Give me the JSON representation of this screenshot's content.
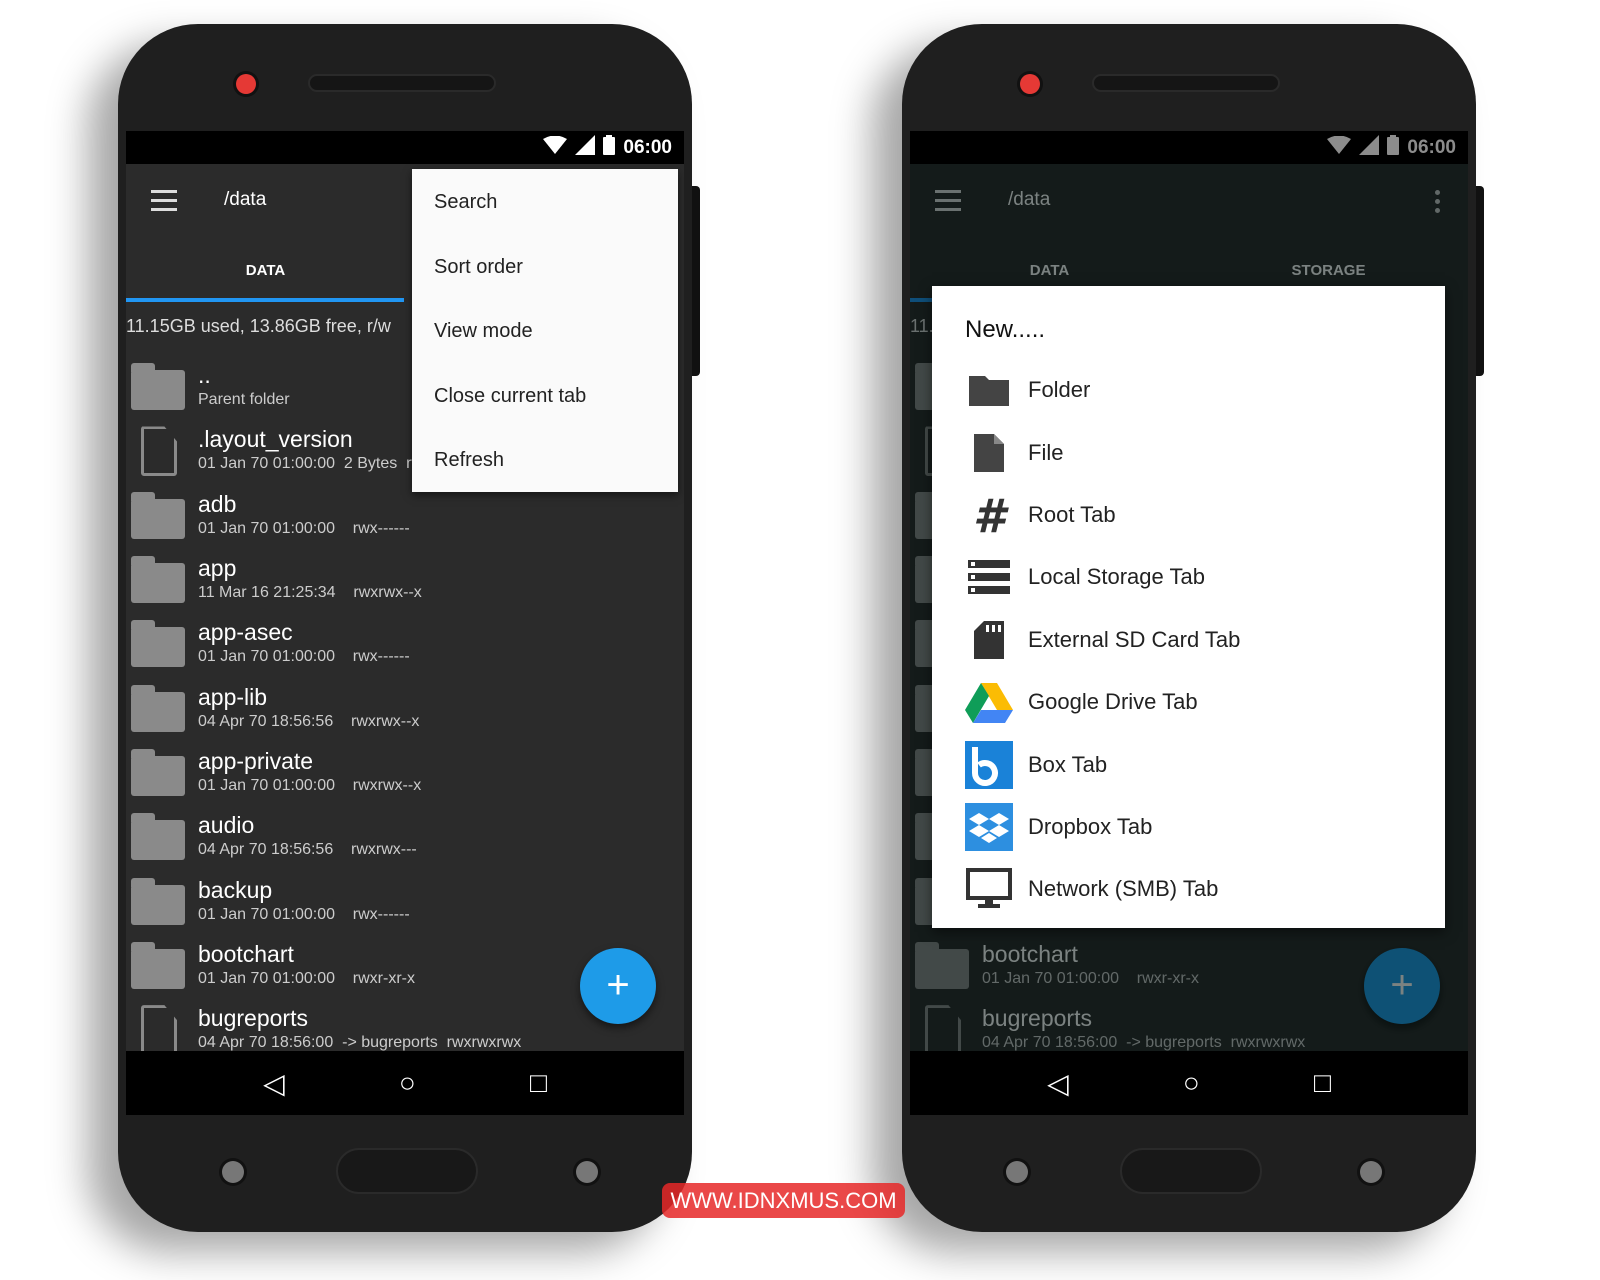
{
  "status": {
    "time": "06:00"
  },
  "toolbar": {
    "path": "/data"
  },
  "tabs": [
    {
      "label": "DATA"
    },
    {
      "label": "STORAGE"
    }
  ],
  "storage_info": "11.15GB used, 13.86GB free, r/w",
  "files": [
    {
      "name": "..",
      "sub": "Parent folder",
      "type": "folder"
    },
    {
      "name": ".layout_version",
      "sub": "01 Jan 70 01:00:00  2 Bytes  rw",
      "type": "file"
    },
    {
      "name": "adb",
      "sub": "01 Jan 70 01:00:00    rwx------",
      "type": "folder"
    },
    {
      "name": "app",
      "sub": "11 Mar 16 21:25:34    rwxrwx--x",
      "type": "folder"
    },
    {
      "name": "app-asec",
      "sub": "01 Jan 70 01:00:00    rwx------",
      "type": "folder"
    },
    {
      "name": "app-lib",
      "sub": "04 Apr 70 18:56:56    rwxrwx--x",
      "type": "folder"
    },
    {
      "name": "app-private",
      "sub": "01 Jan 70 01:00:00    rwxrwx--x",
      "type": "folder"
    },
    {
      "name": "audio",
      "sub": "04 Apr 70 18:56:56    rwxrwx---",
      "type": "folder"
    },
    {
      "name": "backup",
      "sub": "01 Jan 70 01:00:00    rwx------",
      "type": "folder"
    },
    {
      "name": "bootchart",
      "sub": "01 Jan 70 01:00:00    rwxr-xr-x",
      "type": "folder"
    },
    {
      "name": "bugreports",
      "sub": "04 Apr 70 18:56:00  -> bugreports  rwxrwxrwx",
      "type": "file"
    }
  ],
  "overflow_menu": [
    {
      "label": "Search"
    },
    {
      "label": "Sort order"
    },
    {
      "label": "View mode"
    },
    {
      "label": "Close current tab"
    },
    {
      "label": "Refresh"
    }
  ],
  "new_dialog": {
    "title": "New.....",
    "items": [
      {
        "label": "Folder",
        "icon": "folder-icon"
      },
      {
        "label": "File",
        "icon": "file-icon"
      },
      {
        "label": "Root Tab",
        "icon": "hash-icon"
      },
      {
        "label": "Local Storage Tab",
        "icon": "storage-icon"
      },
      {
        "label": "External SD Card Tab",
        "icon": "sd-card-icon"
      },
      {
        "label": "Google Drive Tab",
        "icon": "google-drive-icon"
      },
      {
        "label": "Box Tab",
        "icon": "box-icon"
      },
      {
        "label": "Dropbox Tab",
        "icon": "dropbox-icon"
      },
      {
        "label": "Network (SMB) Tab",
        "icon": "monitor-icon"
      }
    ]
  },
  "fab": {
    "label": "+"
  },
  "watermark": "WWW.IDNXMUS.COM",
  "colors": {
    "accent": "#1e9be8",
    "tab_indicator": "#2196f3",
    "screen_bg": "#2b2b2b"
  }
}
